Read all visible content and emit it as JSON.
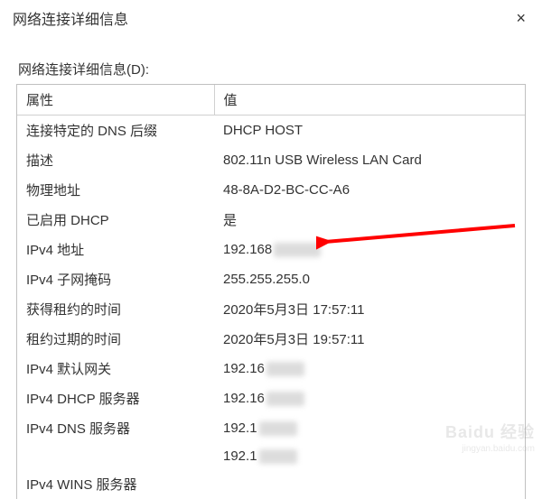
{
  "window": {
    "title": "网络连接详细信息",
    "close_glyph": "×"
  },
  "subtitle": "网络连接详细信息(D):",
  "headers": {
    "property": "属性",
    "value": "值"
  },
  "rows": [
    {
      "property": "连接特定的 DNS 后缀",
      "value": "DHCP HOST"
    },
    {
      "property": "描述",
      "value": "802.11n USB Wireless LAN Card"
    },
    {
      "property": "物理地址",
      "value": "48-8A-D2-BC-CC-A6"
    },
    {
      "property": "已启用 DHCP",
      "value": "是"
    },
    {
      "property": "IPv4 地址",
      "value": "192.168",
      "blur": true
    },
    {
      "property": "IPv4 子网掩码",
      "value": "255.255.255.0"
    },
    {
      "property": "获得租约的时间",
      "value": "2020年5月3日 17:57:11"
    },
    {
      "property": "租约过期的时间",
      "value": "2020年5月3日 19:57:11"
    },
    {
      "property": "IPv4 默认网关",
      "value": "192.16",
      "blur": true
    },
    {
      "property": "IPv4 DHCP 服务器",
      "value": "192.16",
      "blur": true
    },
    {
      "property": "IPv4 DNS 服务器",
      "value": "192.1",
      "blur": true
    },
    {
      "property": "",
      "value": "192.1",
      "blur": true
    },
    {
      "property": "IPv4 WINS 服务器",
      "value": ""
    }
  ],
  "annotation": {
    "arrow_color": "#ff0000"
  },
  "watermark": {
    "brand": "Baidu 经验",
    "footer": "jingyan.baidu.com"
  }
}
